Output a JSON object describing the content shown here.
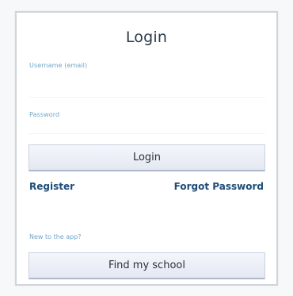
{
  "form": {
    "title": "Login",
    "username_label": "Username (email)",
    "password_label": "Password",
    "login_button": "Login",
    "register_link": "Register",
    "forgot_link": "Forgot Password",
    "new_user_hint": "New to the app?",
    "find_school_button": "Find my school"
  },
  "colors": {
    "accent": "#6fa6c9",
    "link": "#1f4d78",
    "button_bg": "#e9edf5"
  }
}
